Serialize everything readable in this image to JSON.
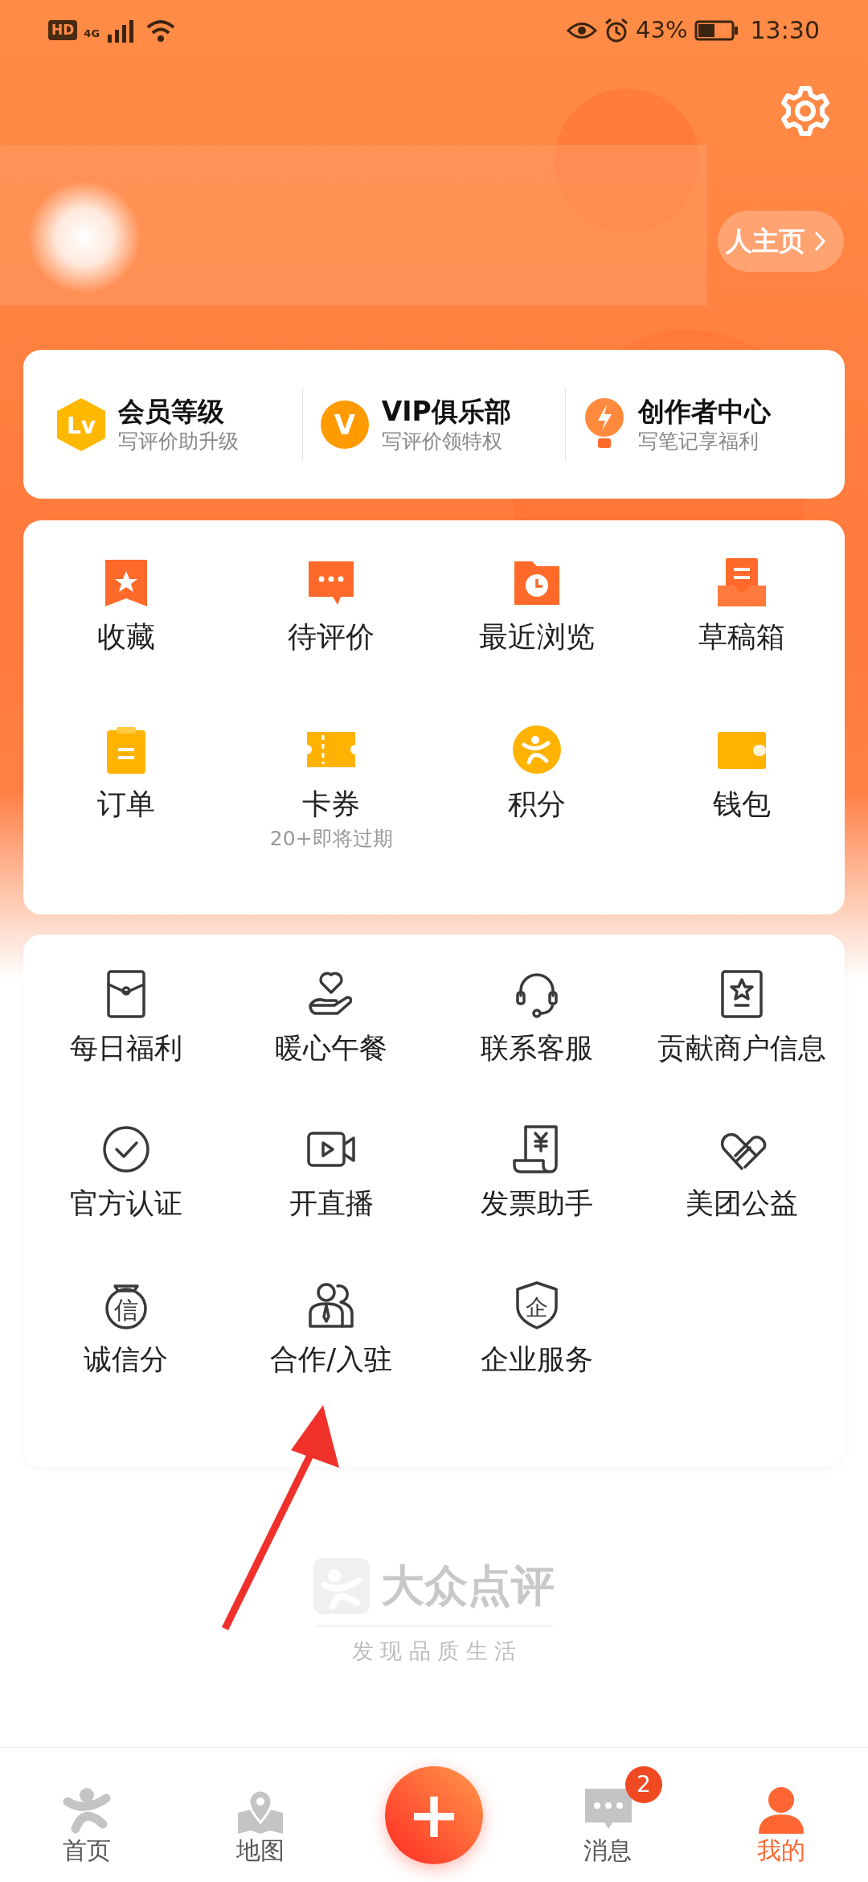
{
  "status_bar": {
    "left": [
      "HD",
      "4G"
    ],
    "battery": "43%",
    "time": "13:30"
  },
  "profile": {
    "homepage_link": "人主页"
  },
  "member_card": [
    {
      "kind": "level",
      "title": "会员等级",
      "subtitle": "写评价助升级",
      "badge": "Lv"
    },
    {
      "kind": "vip",
      "title": "VIP俱乐部",
      "subtitle": "写评价领特权",
      "badge": "V"
    },
    {
      "kind": "creator",
      "title": "创作者中心",
      "subtitle": "写笔记享福利"
    }
  ],
  "my_items": [
    {
      "kind": "favorite",
      "label": "收藏"
    },
    {
      "kind": "review",
      "label": "待评价"
    },
    {
      "kind": "history",
      "label": "最近浏览"
    },
    {
      "kind": "drafts",
      "label": "草稿箱"
    },
    {
      "kind": "orders",
      "label": "订单"
    },
    {
      "kind": "coupons",
      "label": "卡券",
      "note": "20+即将过期"
    },
    {
      "kind": "points",
      "label": "积分"
    },
    {
      "kind": "wallet",
      "label": "钱包"
    }
  ],
  "services": [
    {
      "kind": "envelope",
      "label": "每日福利"
    },
    {
      "kind": "heart-hand",
      "label": "暖心午餐"
    },
    {
      "kind": "headset",
      "label": "联系客服"
    },
    {
      "kind": "star-card",
      "label": "贡献商户信息"
    },
    {
      "kind": "check",
      "label": "官方认证"
    },
    {
      "kind": "video",
      "label": "开直播"
    },
    {
      "kind": "invoice",
      "label": "发票助手"
    },
    {
      "kind": "hearts",
      "label": "美团公益"
    },
    {
      "kind": "credit",
      "label": "诚信分",
      "glyph": "信"
    },
    {
      "kind": "people",
      "label": "合作/入驻"
    },
    {
      "kind": "shield",
      "label": "企业服务",
      "glyph": "企"
    }
  ],
  "brand": {
    "name": "大众点评",
    "slogan": "发 现 品 质 生 活"
  },
  "bottom_nav": [
    {
      "kind": "home",
      "label": "首页",
      "selected": false
    },
    {
      "kind": "map",
      "label": "地图",
      "selected": false
    },
    {
      "kind": "add",
      "glyph": "+"
    },
    {
      "kind": "messages",
      "label": "消息",
      "selected": false,
      "badge": "2"
    },
    {
      "kind": "me",
      "label": "我的",
      "selected": true
    }
  ]
}
